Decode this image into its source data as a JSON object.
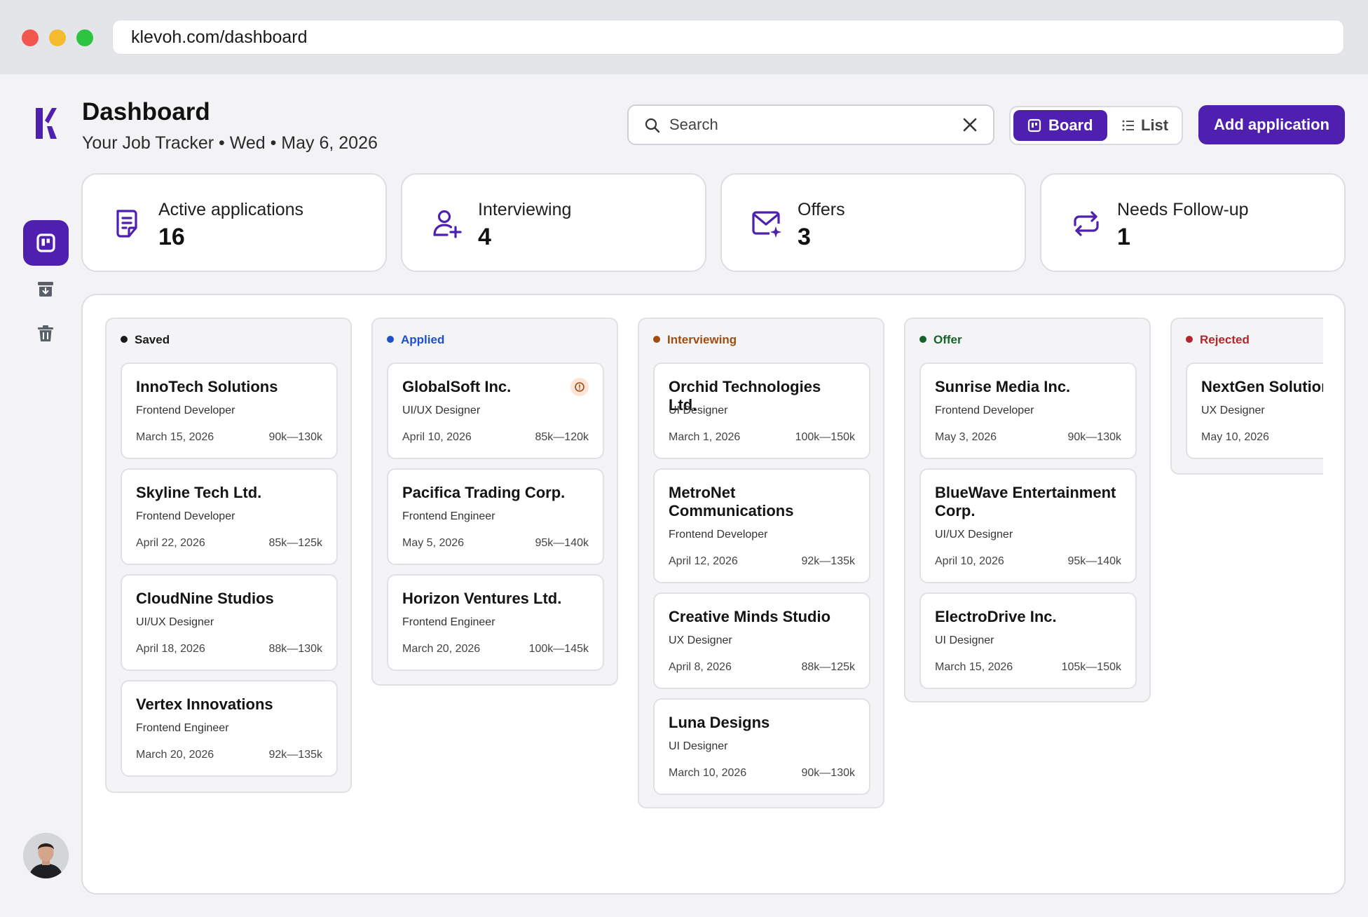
{
  "browser": {
    "url": "klevoh.com/dashboard"
  },
  "header": {
    "title": "Dashboard",
    "subtitle": "Your Job Tracker • Wed • May 6, 2026",
    "search_placeholder": "Search",
    "view_board": "Board",
    "view_list": "List",
    "add_application": "Add application"
  },
  "stats": [
    {
      "label": "Active applications",
      "value": "16",
      "icon": "document-icon"
    },
    {
      "label": "Interviewing",
      "value": "4",
      "icon": "user-add-icon"
    },
    {
      "label": "Offers",
      "value": "3",
      "icon": "mail-sparkle-icon"
    },
    {
      "label": "Needs Follow-up",
      "value": "1",
      "icon": "repeat-icon"
    }
  ],
  "columns": [
    {
      "name": "Saved",
      "color": "#1a1a1a",
      "cards": [
        {
          "company": "InnoTech Solutions",
          "role": "Frontend Developer",
          "date": "March 15, 2026",
          "salary": "90k—130k"
        },
        {
          "company": "Skyline Tech Ltd.",
          "role": "Frontend Developer",
          "date": "April 22, 2026",
          "salary": "85k—125k"
        },
        {
          "company": "CloudNine Studios",
          "role": "UI/UX Designer",
          "date": "April 18, 2026",
          "salary": "88k—130k"
        },
        {
          "company": "Vertex Innovations",
          "role": "Frontend Engineer",
          "date": "March 20, 2026",
          "salary": "92k—135k"
        }
      ]
    },
    {
      "name": "Applied",
      "color": "#1f4fc9",
      "cards": [
        {
          "company": "GlobalSoft Inc.",
          "role": "UI/UX Designer",
          "date": "April 10, 2026",
          "salary": "85k—120k",
          "alert": true
        },
        {
          "company": "Pacifica Trading Corp.",
          "role": "Frontend Engineer",
          "date": "May 5, 2026",
          "salary": "95k—140k"
        },
        {
          "company": "Horizon Ventures Ltd.",
          "role": "Frontend Engineer",
          "date": "March 20, 2026",
          "salary": "100k—145k"
        }
      ]
    },
    {
      "name": "Interviewing",
      "color": "#a14c10",
      "cards": [
        {
          "company": "Orchid Technologies Ltd.",
          "role": "UI Designer",
          "date": "March 1, 2026",
          "salary": "100k—150k"
        },
        {
          "company": "MetroNet Communications",
          "role": "Frontend Developer",
          "date": "April 12, 2026",
          "salary": "92k—135k"
        },
        {
          "company": "Creative Minds Studio",
          "role": "UX Designer",
          "date": "April 8, 2026",
          "salary": "88k—125k"
        },
        {
          "company": "Luna Designs",
          "role": "UI Designer",
          "date": "March 10, 2026",
          "salary": "90k—130k"
        }
      ]
    },
    {
      "name": "Offer",
      "color": "#16632a",
      "cards": [
        {
          "company": "Sunrise Media Inc.",
          "role": "Frontend Developer",
          "date": "May 3, 2026",
          "salary": "90k—130k"
        },
        {
          "company": "BlueWave Entertainment Corp.",
          "role": "UI/UX Designer",
          "date": "April 10, 2026",
          "salary": "95k—140k"
        },
        {
          "company": "ElectroDrive Inc.",
          "role": "UI Designer",
          "date": "March 15, 2026",
          "salary": "105k—150k"
        }
      ]
    },
    {
      "name": "Rejected",
      "color": "#b3262a",
      "cards": [
        {
          "company": "NextGen Solutions",
          "role": "UX Designer",
          "date": "May 10, 2026",
          "salary": ""
        }
      ]
    }
  ],
  "theme": {
    "accent": "#4f1fb0",
    "background": "#f3f3f5"
  }
}
